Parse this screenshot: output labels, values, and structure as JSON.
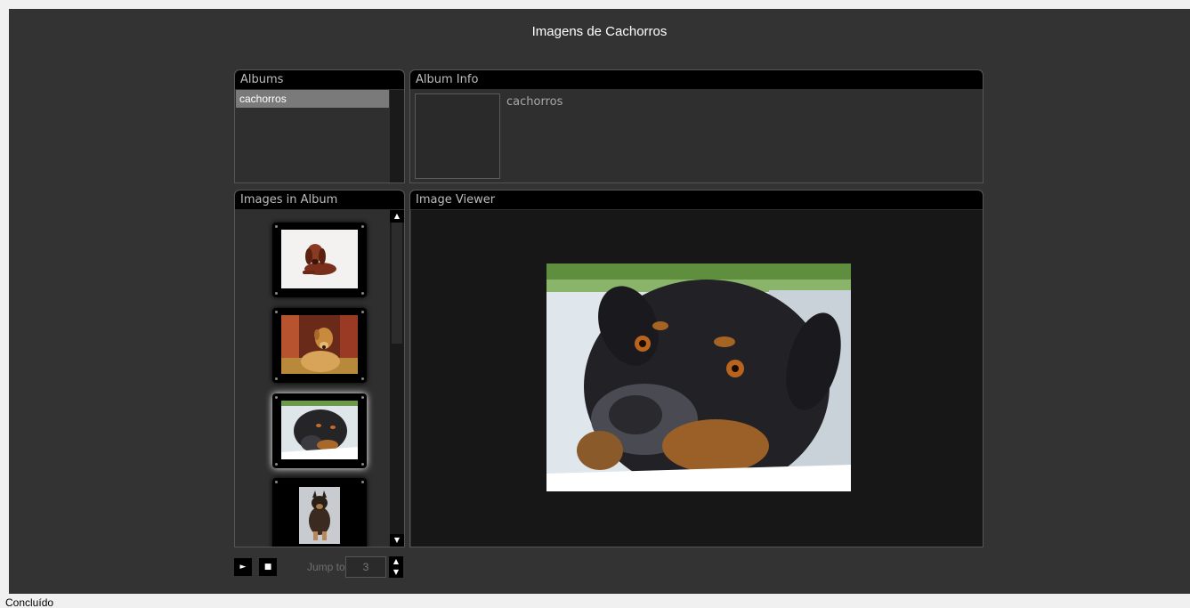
{
  "app": {
    "title": "Imagens de Cachorros"
  },
  "albums": {
    "header": "Albums",
    "items": [
      {
        "label": "cachorros",
        "selected": true
      }
    ]
  },
  "album_info": {
    "header": "Album Info",
    "name": "cachorros"
  },
  "images": {
    "header": "Images in Album",
    "thumbnails": [
      {
        "icon": "dachshund-photo",
        "selected": false
      },
      {
        "icon": "yellow-dog-photo",
        "selected": false
      },
      {
        "icon": "rottweiler-photo",
        "selected": true
      },
      {
        "icon": "german-shepherd-puppy-photo",
        "selected": false
      }
    ]
  },
  "viewer": {
    "header": "Image Viewer",
    "image_icon": "rottweiler-photo"
  },
  "controls": {
    "play_icon": "►",
    "stop_icon": "■",
    "jump_label": "Jump to:",
    "jump_value": "3"
  },
  "status": {
    "text": "Concluído"
  },
  "colors": {
    "background": "#333333",
    "panel_header": "#000000",
    "selection": "#7a7a7a"
  }
}
